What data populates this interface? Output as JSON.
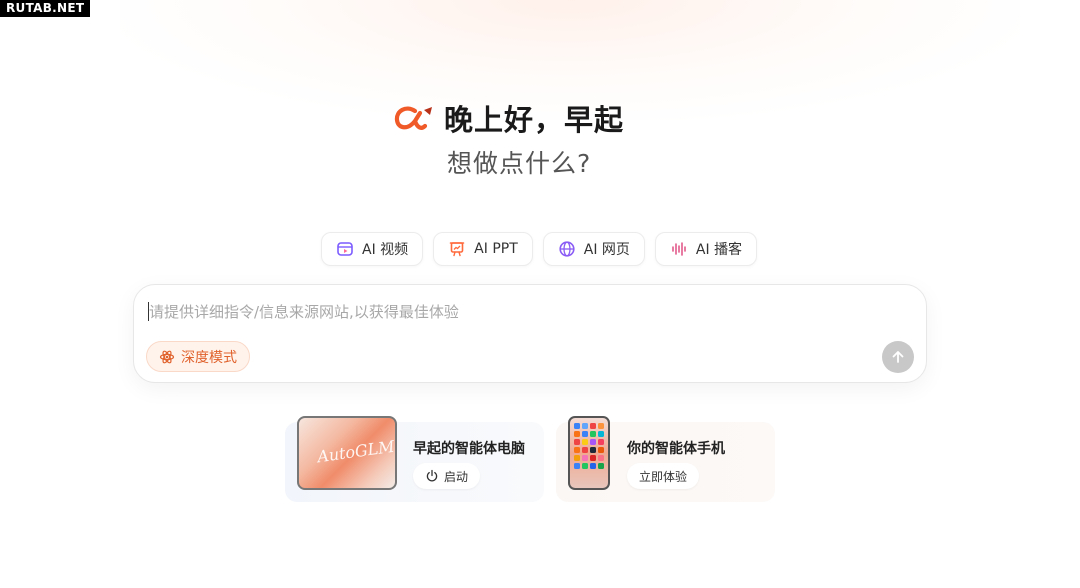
{
  "watermark": "RUTAB.NET",
  "hero": {
    "greeting": "晚上好，早起",
    "subtitle": "想做点什么?"
  },
  "quick_actions": [
    {
      "label": "AI 视频",
      "icon": "video-icon",
      "color": "#7c5cff"
    },
    {
      "label": "AI PPT",
      "icon": "ppt-icon",
      "color": "#ff6a3d"
    },
    {
      "label": "AI 网页",
      "icon": "globe-icon",
      "color": "#8a5cf5"
    },
    {
      "label": "AI 播客",
      "icon": "audio-wave-icon",
      "color": "#e25a8a"
    }
  ],
  "input": {
    "placeholder": "请提供详细指令/信息来源网站,以获得最佳体验",
    "deep_mode_label": "深度模式"
  },
  "cards": [
    {
      "title": "早起的智能体电脑",
      "button_label": "启动",
      "image_text": "AutoGLM"
    },
    {
      "title": "你的智能体手机",
      "button_label": "立即体验"
    }
  ],
  "colors": {
    "brand": "#f05a28",
    "deep_mode": "#e0622c",
    "send_disabled": "#c8c8c8"
  }
}
